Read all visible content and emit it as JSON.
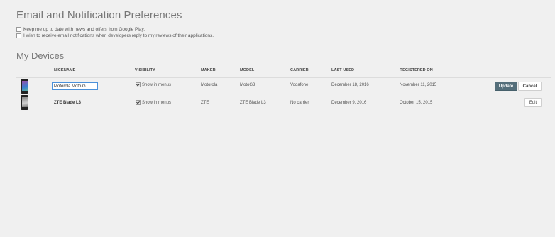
{
  "preferences": {
    "heading": "Email and Notification Preferences",
    "options": [
      {
        "label": "Keep me up to date with news and offers from Google Play.",
        "checked": false
      },
      {
        "label": "I wish to receive email notifications when developers reply to my reviews of their applications.",
        "checked": false
      }
    ]
  },
  "devices": {
    "heading": "My Devices",
    "columns": [
      "NICKNAME",
      "VISIBILITY",
      "MAKER",
      "MODEL",
      "CARRIER",
      "LAST USED",
      "REGISTERED ON"
    ],
    "rows": [
      {
        "nickname": "Motorola Moto G",
        "visibility_label": "Show in menus",
        "visibility_checked": true,
        "maker": "Motorola",
        "model": "MotoG3",
        "carrier": "Vodafone",
        "last_used": "December 18, 2016",
        "registered_on": "November 11, 2015",
        "editing": true,
        "icon": "smartphone-icon"
      },
      {
        "nickname": "ZTE Blade L3",
        "visibility_label": "Show in menus",
        "visibility_checked": true,
        "maker": "ZTE",
        "model": "ZTE Blade L3",
        "carrier": "No carrier",
        "last_used": "December 9, 2016",
        "registered_on": "October 15, 2015",
        "editing": false,
        "icon": "smartphone-icon"
      }
    ],
    "actions": {
      "update_label": "Update",
      "cancel_label": "Cancel",
      "edit_label": "Edit"
    }
  },
  "colors": {
    "background": "#f0f0f0",
    "update_button": "#546e7a",
    "focus_border": "#4a90d9"
  }
}
